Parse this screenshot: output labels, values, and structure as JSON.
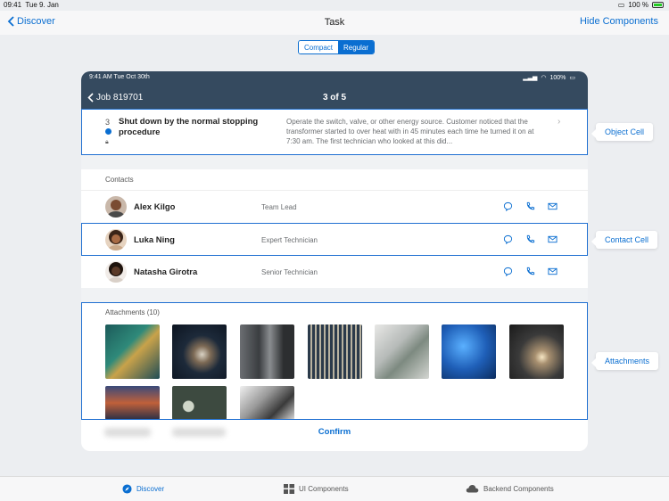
{
  "status": {
    "time": "09:41",
    "date": "Tue 9. Jan",
    "battery": "100 %"
  },
  "nav": {
    "back": "Discover",
    "title": "Task",
    "right": "Hide Components"
  },
  "segmented": {
    "options": [
      "Compact",
      "Regular"
    ],
    "selected": "Regular"
  },
  "device": {
    "status_time": "9:41 AM   Tue Oct 30th",
    "status_battery": "100%",
    "back": "Job 819701",
    "title": "3 of 5"
  },
  "object_cell": {
    "number": "3",
    "title": "Shut down by the normal stopping procedure",
    "description": "Operate the switch, valve, or other energy source. Customer noticed that the transformer started to over heat with in 45 minutes each time he turned it on at 7:30 am. The first technician who looked at this did..."
  },
  "contacts": {
    "label": "Contacts",
    "rows": [
      {
        "name": "Alex Kilgo",
        "role": "Team Lead"
      },
      {
        "name": "Luka Ning",
        "role": "Expert Technician"
      },
      {
        "name": "Natasha Girotra",
        "role": "Senior Technician"
      }
    ]
  },
  "attachments": {
    "label": "Attachments (10)"
  },
  "confirm": "Confirm",
  "callouts": {
    "object": "Object Cell",
    "contact": "Contact Cell",
    "attachments": "Attachments"
  },
  "tabs": [
    {
      "label": "Discover",
      "icon": "compass-icon"
    },
    {
      "label": "UI Components",
      "icon": "grid-icon"
    },
    {
      "label": "Backend Components",
      "icon": "cloud-icon"
    }
  ],
  "colors": {
    "accent": "#0a6ed1",
    "shell": "#354a5f",
    "highlight": "#1f6fd1"
  }
}
